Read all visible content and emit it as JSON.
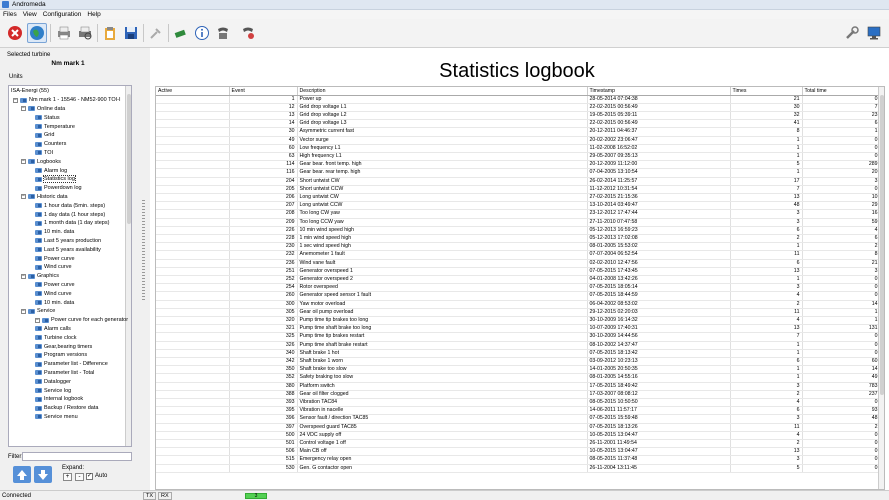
{
  "window": {
    "title": "Andromeda"
  },
  "menu": [
    "Files",
    "View",
    "Configuration",
    "Help"
  ],
  "toolbar_icons": [
    "stop-icon",
    "globe-icon",
    "print-icon",
    "print-preview-icon",
    "clipboard-icon",
    "save-icon",
    "plug-icon",
    "connect-icon",
    "info-icon",
    "phone-icon",
    "phone-settings-icon",
    "tools-icon",
    "computer-icon"
  ],
  "left": {
    "selected_turbine_label": "Selected turbine",
    "turbine_name": "Nm mark 1",
    "units_label": "Units",
    "tree": [
      {
        "text": "ISA-Energi (55)",
        "level": 0,
        "type": "text"
      },
      {
        "text": "Nm mark 1 - 15546 - NM52-900 TOI-I",
        "level": 1,
        "type": "expand"
      },
      {
        "text": "Online data",
        "level": 2,
        "type": "folder"
      },
      {
        "text": "Status",
        "level": 3,
        "type": "leaf"
      },
      {
        "text": "Temperature",
        "level": 3,
        "type": "leaf"
      },
      {
        "text": "Grid",
        "level": 3,
        "type": "leaf"
      },
      {
        "text": "Counters",
        "level": 3,
        "type": "leaf"
      },
      {
        "text": "TOI",
        "level": 3,
        "type": "leaf"
      },
      {
        "text": "Logbooks",
        "level": 2,
        "type": "folder"
      },
      {
        "text": "Alarm log",
        "level": 3,
        "type": "leaf"
      },
      {
        "text": "Statistics log",
        "level": 3,
        "type": "leaf",
        "selected": true
      },
      {
        "text": "Powerdown log",
        "level": 3,
        "type": "leaf"
      },
      {
        "text": "Historic data",
        "level": 2,
        "type": "folder"
      },
      {
        "text": "1 hour data (5min. steps)",
        "level": 3,
        "type": "leaf"
      },
      {
        "text": "1 day data (1 hour steps)",
        "level": 3,
        "type": "leaf"
      },
      {
        "text": "1 month data (1 day steps)",
        "level": 3,
        "type": "leaf"
      },
      {
        "text": "10 min. data",
        "level": 3,
        "type": "leaf"
      },
      {
        "text": "Last 5 years production",
        "level": 3,
        "type": "leaf"
      },
      {
        "text": "Last 5 years availability",
        "level": 3,
        "type": "leaf"
      },
      {
        "text": "Power curve",
        "level": 3,
        "type": "leaf"
      },
      {
        "text": "Wind curve",
        "level": 3,
        "type": "leaf"
      },
      {
        "text": "Graphics",
        "level": 2,
        "type": "folder"
      },
      {
        "text": "Power curve",
        "level": 3,
        "type": "leaf"
      },
      {
        "text": "Wind curve",
        "level": 3,
        "type": "leaf"
      },
      {
        "text": "10 min. data",
        "level": 3,
        "type": "leaf"
      },
      {
        "text": "Service",
        "level": 2,
        "type": "folder"
      },
      {
        "text": "Power curve for each generator",
        "level": 3,
        "type": "expand"
      },
      {
        "text": "Alarm calls",
        "level": 3,
        "type": "leaf"
      },
      {
        "text": "Turbine clock",
        "level": 3,
        "type": "leaf"
      },
      {
        "text": "Gear,bearing timers",
        "level": 3,
        "type": "leaf"
      },
      {
        "text": "Program versions",
        "level": 3,
        "type": "leaf"
      },
      {
        "text": "Parameter list - Difference",
        "level": 3,
        "type": "leaf"
      },
      {
        "text": "Parameter list - Total",
        "level": 3,
        "type": "leaf"
      },
      {
        "text": "Datalogger",
        "level": 3,
        "type": "leaf"
      },
      {
        "text": "Service log",
        "level": 3,
        "type": "leaf"
      },
      {
        "text": "Internal logbook",
        "level": 3,
        "type": "leaf"
      },
      {
        "text": "Backup / Restore data",
        "level": 3,
        "type": "leaf"
      },
      {
        "text": "Service menu",
        "level": 3,
        "type": "leaf"
      }
    ],
    "filter_label": "Filter:",
    "expand_label": "Expand:",
    "expand_plus": "+",
    "expand_minus": "-",
    "auto_label": "Auto",
    "auto_checked": "✓"
  },
  "main": {
    "title": "Statistics logbook",
    "columns": [
      "Active",
      "Event",
      "Description",
      "Timestamp",
      "Times",
      "Total time"
    ],
    "rows": [
      [
        "",
        "1",
        "Power up",
        "28-05-2014 07:04:38",
        "21",
        "0"
      ],
      [
        "",
        "12",
        "Grid drop voltage L1",
        "22-02-2015 00:56:49",
        "30",
        "7"
      ],
      [
        "",
        "13",
        "Grid drop voltage L2",
        "19-05-2015 05:39:11",
        "32",
        "23"
      ],
      [
        "",
        "14",
        "Grid drop voltage L3",
        "22-02-2015 00:56:49",
        "41",
        "6"
      ],
      [
        "",
        "30",
        "Asymmetric current fast",
        "20-12-2011 04:46:37",
        "8",
        "1"
      ],
      [
        "",
        "49",
        "Vector surge",
        "20-02-2002 23:06:47",
        "1",
        "0"
      ],
      [
        "",
        "60",
        "Low frequency L1",
        "11-02-2008 16:52:02",
        "1",
        "0"
      ],
      [
        "",
        "63",
        "High frequency L1",
        "29-05-2007 09:35:13",
        "1",
        "0"
      ],
      [
        "",
        "114",
        "Gear bear. front temp. high",
        "20-12-2009 11:12:00",
        "5",
        "289"
      ],
      [
        "",
        "116",
        "Gear bear. rear temp. high",
        "07-04-2005 13:10:54",
        "1",
        "20"
      ],
      [
        "",
        "204",
        "Short untwist CW",
        "26-02-2014 11:25:57",
        "17",
        "3"
      ],
      [
        "",
        "205",
        "Short untwist CCW",
        "11-12-2012 10:31:54",
        "7",
        "0"
      ],
      [
        "",
        "206",
        "Long untwist CW",
        "27-02-2015 21:15:36",
        "13",
        "10"
      ],
      [
        "",
        "207",
        "Long untwist CCW",
        "13-10-2014 03:49:47",
        "48",
        "29"
      ],
      [
        "",
        "208",
        "Too long CW yaw",
        "23-12-2012 17:47:44",
        "3",
        "16"
      ],
      [
        "",
        "209",
        "Too long CCW yaw",
        "27-11-2010 07:47:58",
        "3",
        "59"
      ],
      [
        "",
        "226",
        "10 min wind speed high",
        "05-12-2013 16:59:23",
        "6",
        "4"
      ],
      [
        "",
        "228",
        "1 min wind speed high",
        "05-12-2013 17:02:08",
        "2",
        "6"
      ],
      [
        "",
        "230",
        "1 sec wind speed high",
        "08-01-2005 15:53:02",
        "1",
        "2"
      ],
      [
        "",
        "232",
        "Anemometer 1 fault",
        "07-07-2004 06:52:54",
        "11",
        "8"
      ],
      [
        "",
        "236",
        "Wind vane fault",
        "02-02-2010 12:47:56",
        "6",
        "21"
      ],
      [
        "",
        "251",
        "Generator overspeed 1",
        "07-05-2015 17:43:45",
        "13",
        "3"
      ],
      [
        "",
        "252",
        "Generator overspeed 2",
        "04-01-2008 13:42:26",
        "1",
        "0"
      ],
      [
        "",
        "254",
        "Rotor overspeed",
        "07-05-2015 18:05:14",
        "3",
        "0"
      ],
      [
        "",
        "260",
        "Generator speed sensor 1 fault",
        "07-05-2015 18:44:59",
        "4",
        "0"
      ],
      [
        "",
        "300",
        "Yaw motor overload",
        "06-04-2002 08:53:02",
        "2",
        "14"
      ],
      [
        "",
        "305",
        "Gear oil pump overload",
        "29-12-2015 02:20:03",
        "11",
        "1"
      ],
      [
        "",
        "320",
        "Pump time tip brakes too long",
        "30-10-2009 16:14:32",
        "4",
        "1"
      ],
      [
        "",
        "321",
        "Pump time shaft brake too long",
        "10-07-2009 17:40:31",
        "13",
        "131"
      ],
      [
        "",
        "325",
        "Pump time tip brakes restart",
        "30-10-2009 14:44:56",
        "7",
        "0"
      ],
      [
        "",
        "326",
        "Pump time shaft brake restart",
        "08-10-2002 14:37:47",
        "1",
        "0"
      ],
      [
        "",
        "340",
        "Shaft brake 1 hot",
        "07-05-2015 18:13:42",
        "1",
        "0"
      ],
      [
        "",
        "342",
        "Shaft brake 1 worn",
        "03-09-2012 10:23:13",
        "6",
        "60"
      ],
      [
        "",
        "350",
        "Shaft brake too slow",
        "14-01-2005 20:50:35",
        "1",
        "14"
      ],
      [
        "",
        "352",
        "Safety braking too slow",
        "08-01-2005 14:55:16",
        "1",
        "49"
      ],
      [
        "",
        "380",
        "Platform switch",
        "17-05-2015 18:49:42",
        "3",
        "783"
      ],
      [
        "",
        "388",
        "Gear oil filter clogged",
        "17-03-2007 08:08:12",
        "2",
        "237"
      ],
      [
        "",
        "393",
        "Vibration TAC84",
        "08-05-2015 10:50:50",
        "4",
        "0"
      ],
      [
        "",
        "395",
        "Vibration in nacelle",
        "14-06-2011 11:57:17",
        "6",
        "93"
      ],
      [
        "",
        "396",
        "Sensor fault / direction TAC85",
        "07-05-2015 15:59:48",
        "3",
        "48"
      ],
      [
        "",
        "397",
        "Overspeed guard TAC85",
        "07-05-2015 18:13:26",
        "11",
        "2"
      ],
      [
        "",
        "500",
        "24 VDC supply off",
        "10-05-2015 13:04:47",
        "4",
        "0"
      ],
      [
        "",
        "501",
        "Control voltage 1 off",
        "26-11-2001 11:49:54",
        "2",
        "0"
      ],
      [
        "",
        "506",
        "Main CB off",
        "10-05-2015 13:04:47",
        "13",
        "0"
      ],
      [
        "",
        "515",
        "Emergency relay open",
        "08-05-2015 11:37:48",
        "3",
        "0"
      ],
      [
        "",
        "530",
        "Gen. G contactor open",
        "26-11-2004 13:11:45",
        "5",
        "0"
      ]
    ]
  },
  "status": {
    "text": "Connected",
    "tx": "TX",
    "rx": "RX",
    "indicator": "3"
  }
}
